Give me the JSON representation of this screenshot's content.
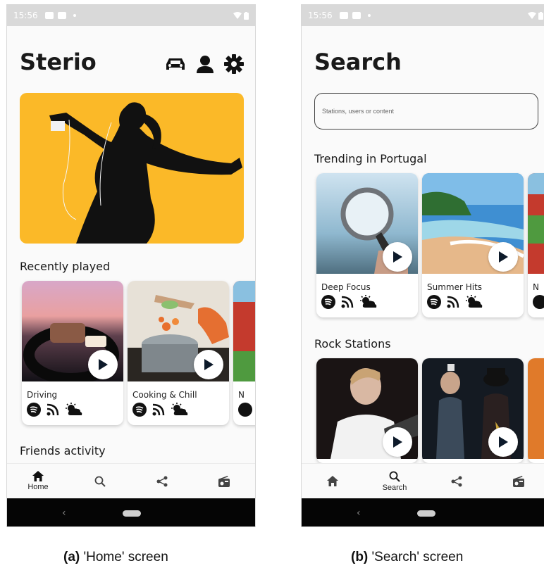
{
  "home": {
    "status_time": "15:56",
    "title": "Sterio",
    "recently_label": "Recently played",
    "friends_label": "Friends activity",
    "cards": [
      {
        "label": "Driving"
      },
      {
        "label": "Cooking & Chill"
      },
      {
        "label": "N"
      }
    ],
    "tabs": [
      {
        "label": "Home",
        "icon": "home-icon"
      },
      {
        "label": "",
        "icon": "search-icon"
      },
      {
        "label": "",
        "icon": "share-icon"
      },
      {
        "label": "",
        "icon": "radio-icon"
      }
    ]
  },
  "search": {
    "status_time": "15:56",
    "title": "Search",
    "input_placeholder": "Stations, users or content",
    "trending_label": "Trending in Portugal",
    "rock_label": "Rock Stations",
    "trending_cards": [
      {
        "label": "Deep Focus"
      },
      {
        "label": "Summer Hits"
      },
      {
        "label": "N"
      }
    ],
    "tabs": [
      {
        "label": "",
        "icon": "home-icon"
      },
      {
        "label": "Search",
        "icon": "search-icon"
      },
      {
        "label": "",
        "icon": "share-icon"
      },
      {
        "label": "",
        "icon": "radio-icon"
      }
    ]
  },
  "captions": {
    "a_tag": "(a)",
    "a_text": " 'Home' screen",
    "b_tag": "(b)",
    "b_text": " 'Search' screen"
  },
  "colors": {
    "hero_bg": "#fbb928",
    "statusbar": "#d9d9d9",
    "navbar": "#050505"
  }
}
